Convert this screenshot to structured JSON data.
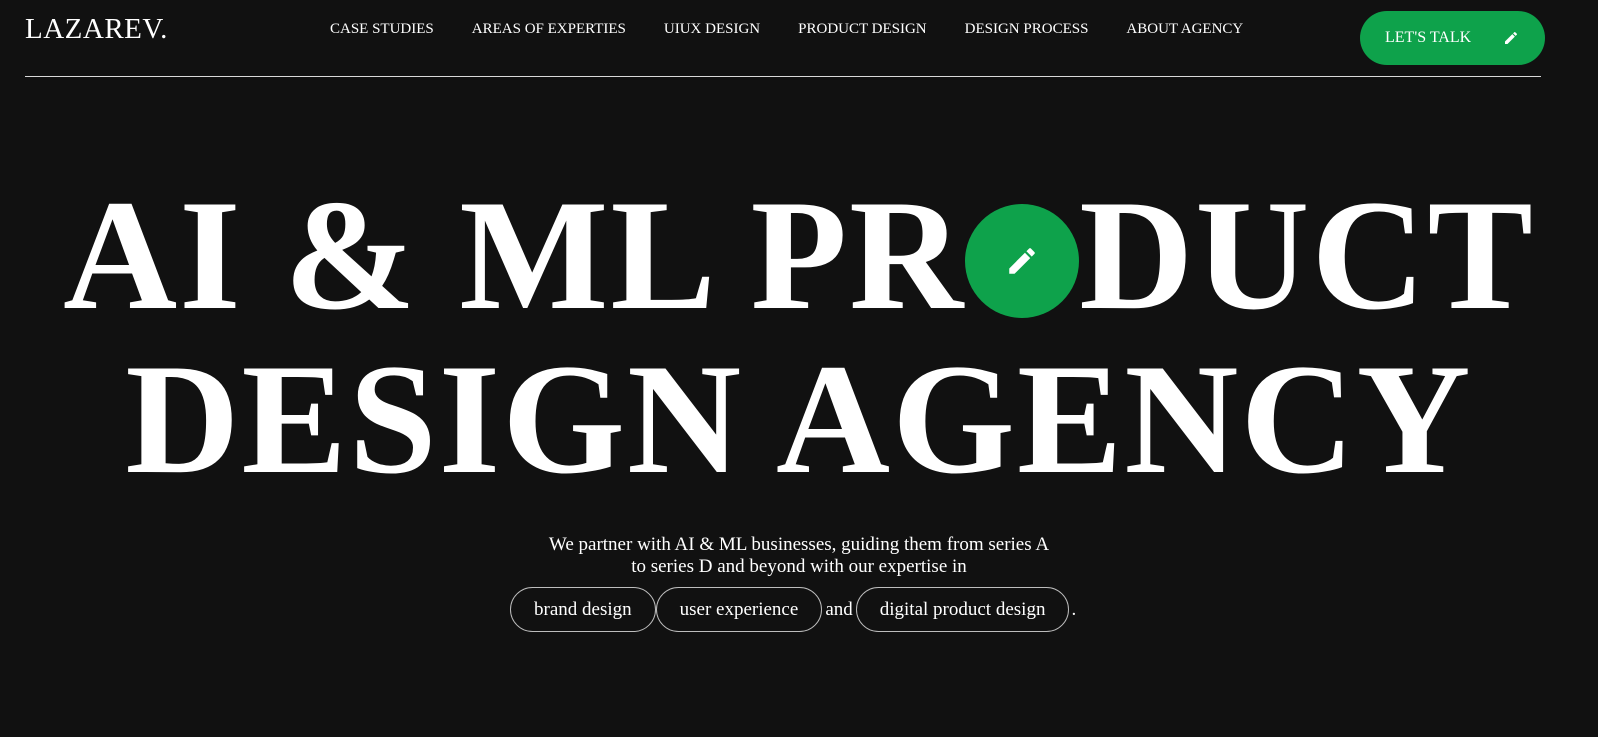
{
  "header": {
    "logo": "LAZAREV.",
    "nav": [
      "CASE STUDIES",
      "AREAS OF EXPERTIES",
      "UIUX DESIGN",
      "PRODUCT DESIGN",
      "DESIGN PROCESS",
      "ABOUT AGENCY"
    ],
    "cta_label": "LET'S TALK"
  },
  "hero": {
    "line1_before": "AI & ML PR",
    "line1_after": "DUCT",
    "line2": "DESIGN AGENCY",
    "subtitle_line1": "We partner with AI & ML businesses, guiding them from series A",
    "subtitle_line2": "to series D and beyond with our expertise in",
    "pill1": "brand design",
    "pill2": "user experience",
    "connector": "and",
    "pill3": "digital product design",
    "end_punct": "."
  },
  "colors": {
    "background": "#111111",
    "accent": "#0ea24b",
    "text": "#ffffff"
  },
  "icons": {
    "cta_icon": "pencil-icon",
    "hero_icon": "pencil-icon"
  }
}
